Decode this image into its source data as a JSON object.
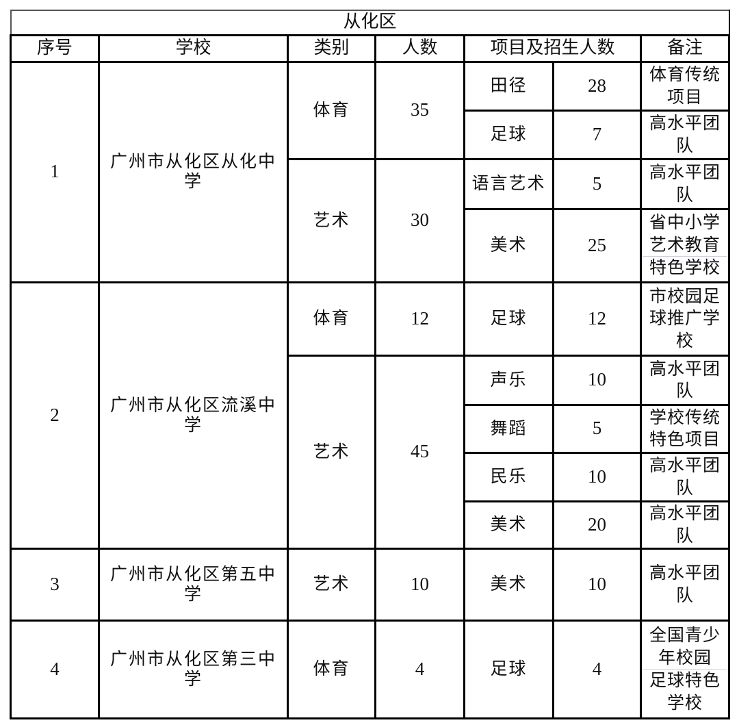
{
  "title": "从化区",
  "headers": {
    "index": "序号",
    "school": "学校",
    "category": "类别",
    "count": "人数",
    "projects": "项目及招生人数",
    "remarks": "备注"
  },
  "rows": [
    {
      "index": "1",
      "school": "广州市从化区从化中学",
      "groups": [
        {
          "category": "体育",
          "count": "35",
          "projects": [
            {
              "name": "田径",
              "quota": "28",
              "remark": "体育传统项目"
            },
            {
              "name": "足球",
              "quota": "7",
              "remark": "高水平团队"
            }
          ]
        },
        {
          "category": "艺术",
          "count": "30",
          "projects": [
            {
              "name": "语言艺术",
              "quota": "5",
              "remark": "高水平团队"
            },
            {
              "name": "美术",
              "quota": "25",
              "remark": "省中小学艺术教育",
              "remark_extra": "特色学校"
            }
          ]
        }
      ]
    },
    {
      "index": "2",
      "school": "广州市从化区流溪中学",
      "groups": [
        {
          "category": "体育",
          "count": "12",
          "projects": [
            {
              "name": "足球",
              "quota": "12",
              "remark": "市校园足球推广学校"
            }
          ]
        },
        {
          "category": "艺术",
          "count": "45",
          "projects": [
            {
              "name": "声乐",
              "quota": "10",
              "remark": "高水平团队"
            },
            {
              "name": "舞蹈",
              "quota": "5",
              "remark": "学校传统特色项目"
            },
            {
              "name": "民乐",
              "quota": "10",
              "remark": "高水平团队"
            },
            {
              "name": "美术",
              "quota": "20",
              "remark": "高水平团队"
            }
          ]
        }
      ]
    },
    {
      "index": "3",
      "school": "广州市从化区第五中学",
      "groups": [
        {
          "category": "艺术",
          "count": "10",
          "projects": [
            {
              "name": "美术",
              "quota": "10",
              "remark": "高水平团队"
            }
          ]
        }
      ]
    },
    {
      "index": "4",
      "school": "广州市从化区第三中学",
      "groups": [
        {
          "category": "体育",
          "count": "4",
          "projects": [
            {
              "name": "足球",
              "quota": "4",
              "remark": "全国青少年校园",
              "remark_extra": "足球特色学校"
            }
          ]
        }
      ]
    }
  ]
}
